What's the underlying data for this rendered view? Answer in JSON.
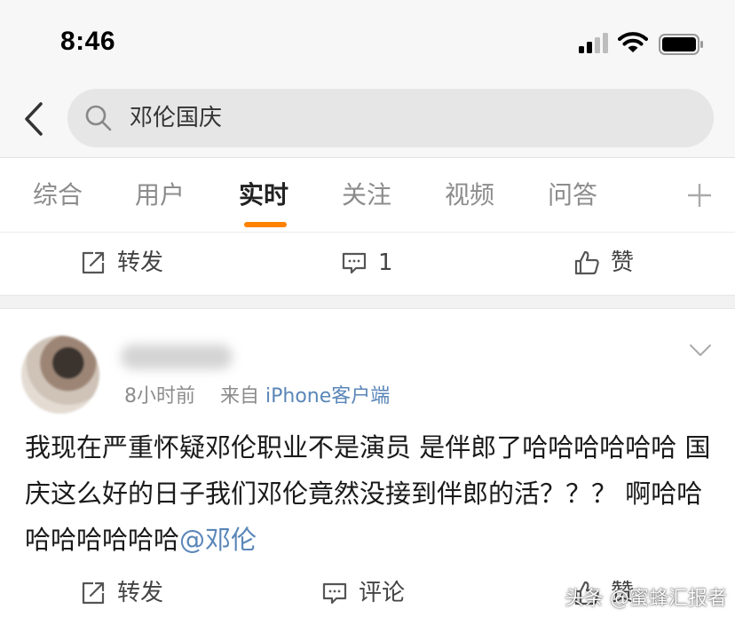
{
  "status_bar": {
    "time": "8:46"
  },
  "search": {
    "query": "邓伦国庆"
  },
  "tabs": [
    {
      "label": "综合"
    },
    {
      "label": "用户"
    },
    {
      "label": "实时"
    },
    {
      "label": "关注"
    },
    {
      "label": "视频"
    },
    {
      "label": "问答"
    }
  ],
  "colors": {
    "accent": "#ff8200",
    "link": "#5a86b8"
  },
  "top_actions": {
    "repost_label": "转发",
    "comment_count": "1",
    "like_label": "赞"
  },
  "post": {
    "time_ago": "8小时前",
    "from_prefix": "来自",
    "source": "iPhone客户端",
    "text": "我现在严重怀疑邓伦职业不是演员 是伴郎了哈哈哈哈哈哈 国庆这么好的日子我们邓伦竟然没接到伴郎的活？？？ 啊哈哈哈哈哈哈哈哈",
    "mention": "@邓伦"
  },
  "bottom_actions": {
    "repost_label": "转发",
    "comment_label": "评论",
    "like_label": "赞"
  },
  "watermark": "头条 @蜜蜂汇报者"
}
